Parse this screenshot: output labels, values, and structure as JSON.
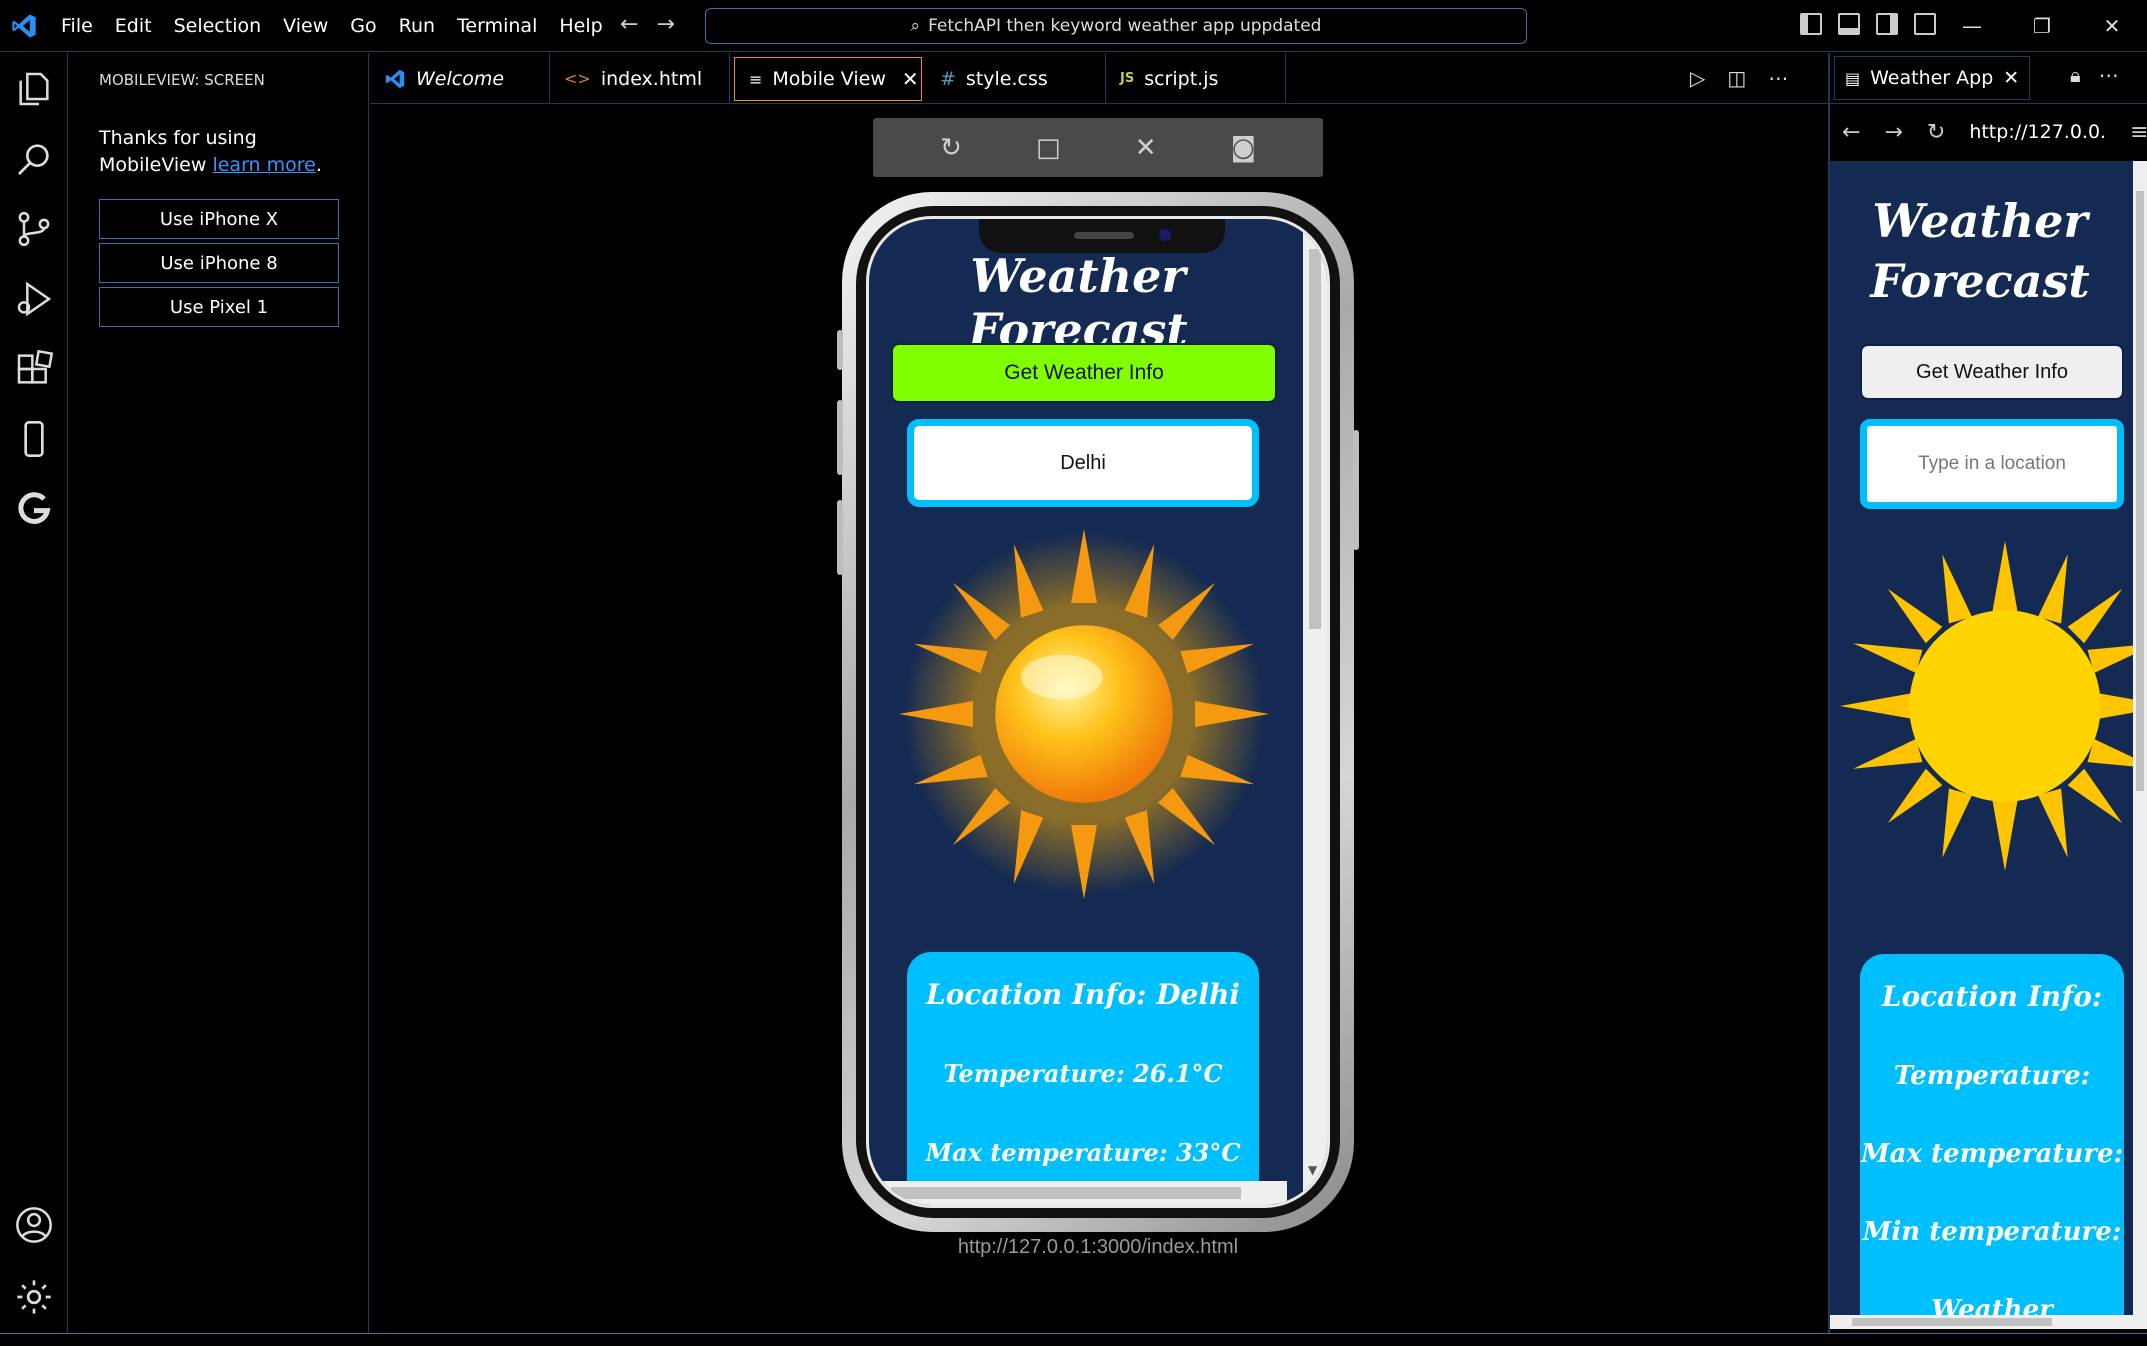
{
  "menu": [
    "File",
    "Edit",
    "Selection",
    "View",
    "Go",
    "Run",
    "Terminal",
    "Help"
  ],
  "command_center": "FetchAPI then keyword weather app uppdated",
  "sidebar": {
    "title": "MOBILEVIEW: SCREEN",
    "thanks_text": "Thanks for using MobileView",
    "learn_more": "learn more",
    "period": ".",
    "buttons": [
      "Use iPhone X",
      "Use iPhone 8",
      "Use Pixel 1"
    ]
  },
  "tabs": [
    {
      "label": "Welcome",
      "icon": "vscode-icon"
    },
    {
      "label": "index.html",
      "icon": "html-icon"
    },
    {
      "label": "Mobile View",
      "icon": "preview-icon",
      "active": true
    },
    {
      "label": "style.css",
      "icon": "css-hash-icon"
    },
    {
      "label": "script.js",
      "icon": "js-icon"
    }
  ],
  "mobile_app": {
    "title": "Weather Forecast",
    "button": "Get Weather Info",
    "input_value": "Delhi",
    "card_heading": "Location Info: Delhi",
    "temperature": "Temperature: 26.1°C",
    "max_temperature": "Max temperature: 33°C",
    "accent_green": "#7fff00",
    "accent_blue": "#00bfff",
    "background": "#142a52"
  },
  "phone_url": "http://127.0.0.1:3000/index.html",
  "browser_pane": {
    "tab_label": "Weather App",
    "url": "http://127.0.0.",
    "title": "Weather Forecast",
    "button": "Get Weather Info",
    "input_placeholder": "Type in a location",
    "card_heading": "Location Info:",
    "temperature": "Temperature:",
    "max_temperature": "Max temperature:",
    "min_temperature": "Min temperature:",
    "weather_condition": "Weather condition:"
  }
}
